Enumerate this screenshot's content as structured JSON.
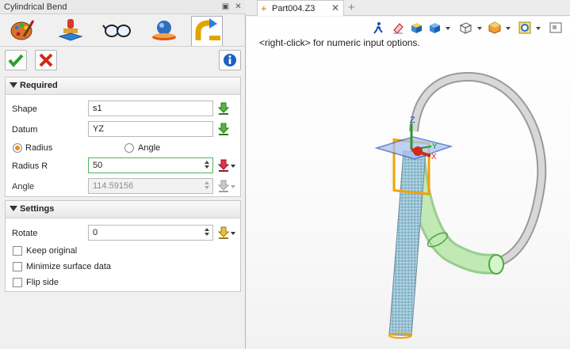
{
  "panel": {
    "title": "Cylindrical Bend",
    "pin_icon": "pin-icon",
    "close_icon": "close-icon",
    "tools": [
      {
        "name": "bend-tool-1",
        "icon": "palette-brush-icon"
      },
      {
        "name": "bend-tool-2",
        "icon": "stamp-icon"
      },
      {
        "name": "bend-tool-3",
        "icon": "glasses-icon"
      },
      {
        "name": "bend-tool-4",
        "icon": "sphere-wrap-icon"
      },
      {
        "name": "bend-tool-5",
        "icon": "cylindrical-bend-icon"
      }
    ],
    "ok_icon": "check-icon",
    "cancel_icon": "cross-icon",
    "info_icon": "info-icon"
  },
  "required": {
    "header": "Required",
    "shape_label": "Shape",
    "shape_value": "s1",
    "datum_label": "Datum",
    "datum_value": "YZ",
    "radius_option": "Radius",
    "angle_option": "Angle",
    "radius_label": "Radius R",
    "radius_value": "50",
    "angle_label": "Angle",
    "angle_value": "114.59156"
  },
  "settings": {
    "header": "Settings",
    "rotate_label": "Rotate",
    "rotate_value": "0",
    "keep_original": "Keep original",
    "minimize_surface": "Minimize surface data",
    "flip_side": "Flip side"
  },
  "document": {
    "tab_name": "Part004.Z3",
    "hint": "<right-click> for numeric input options.",
    "axis_x": "X",
    "axis_y": "Y",
    "axis_z": "Z"
  },
  "colors": {
    "accent": "#f08a1c",
    "active_field": "#53b45a"
  }
}
